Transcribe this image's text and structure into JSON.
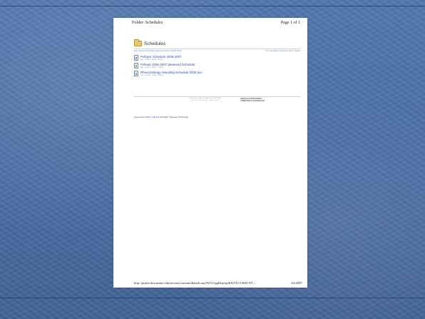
{
  "header": {
    "left": "Folder: Schedules",
    "right": "Page 1 of 1"
  },
  "folder": {
    "title": "Schedules",
    "icon": "folder-icon"
  },
  "toolbar": {
    "left": "New Content  Technology  Settings  Favorites  Upload  Public",
    "right": "Print  |  My Books  |  Previous  |  Next  |  Search"
  },
  "documents": [
    {
      "title": "Fellows' Schedule 2006-2007",
      "meta": "edit · rename · delete · history"
    },
    {
      "title": "Fellows 2006-2007 Weekend Schedule",
      "meta": "edit · rename · delete · history"
    },
    {
      "title": "Rheumatology Attending Schedule 2006.doc",
      "meta": "edit · rename · delete · history"
    }
  ],
  "footer_block": {
    "address_line1": "450 Clarkson Ave, Brooklyn, NY 11203-2098",
    "address_line2": "Tel: (718) 270-1234  Fax: (718) 270-1567",
    "office_line1": "OFFICE OF EDUCATIONAL",
    "office_line2": "COMPUTING & TECHNOLOGY"
  },
  "powered": {
    "prefix": "powered by",
    "link": "ASGS, Learning",
    "suffix": "WorkSite™ Browser Technology"
  },
  "page_footer": {
    "url": "http://prime.downstate.edu/section/content/default.asp?WCI=pgDisplay&WCU=CRSCNT...",
    "date": "3/4/2007"
  }
}
